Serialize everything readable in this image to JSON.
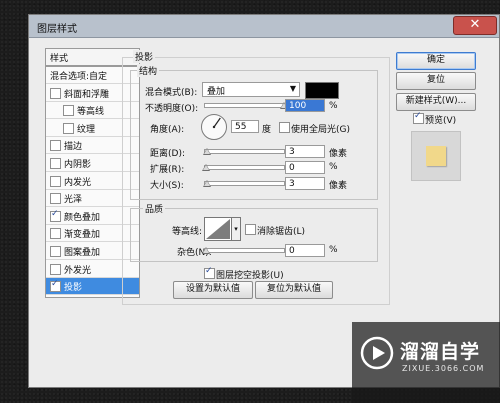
{
  "window": {
    "title": "图层样式",
    "close_glyph": "✕"
  },
  "left_panel": {
    "header": "样式",
    "items": [
      {
        "label": "混合选项:自定",
        "checkbox": false,
        "checked": false,
        "indent": false,
        "selected": false
      },
      {
        "label": "斜面和浮雕",
        "checkbox": true,
        "checked": false,
        "indent": false,
        "selected": false
      },
      {
        "label": "等高线",
        "checkbox": true,
        "checked": false,
        "indent": true,
        "selected": false
      },
      {
        "label": "纹理",
        "checkbox": true,
        "checked": false,
        "indent": true,
        "selected": false
      },
      {
        "label": "描边",
        "checkbox": true,
        "checked": false,
        "indent": false,
        "selected": false
      },
      {
        "label": "内阴影",
        "checkbox": true,
        "checked": false,
        "indent": false,
        "selected": false
      },
      {
        "label": "内发光",
        "checkbox": true,
        "checked": false,
        "indent": false,
        "selected": false
      },
      {
        "label": "光泽",
        "checkbox": true,
        "checked": false,
        "indent": false,
        "selected": false
      },
      {
        "label": "颜色叠加",
        "checkbox": true,
        "checked": true,
        "indent": false,
        "selected": false
      },
      {
        "label": "渐变叠加",
        "checkbox": true,
        "checked": false,
        "indent": false,
        "selected": false
      },
      {
        "label": "图案叠加",
        "checkbox": true,
        "checked": false,
        "indent": false,
        "selected": false
      },
      {
        "label": "外发光",
        "checkbox": true,
        "checked": false,
        "indent": false,
        "selected": false
      },
      {
        "label": "投影",
        "checkbox": true,
        "checked": true,
        "indent": false,
        "selected": true
      }
    ]
  },
  "panel": {
    "title": "投影",
    "structure": {
      "title": "结构",
      "blend_mode_label": "混合模式(B):",
      "blend_mode_value": "叠加",
      "shadow_color": "#000000",
      "opacity_label": "不透明度(O):",
      "opacity_value": "100",
      "opacity_unit": "%",
      "opacity_percent": 100,
      "angle_label": "角度(A):",
      "angle_value": "55",
      "angle_unit": "度",
      "global_light_label": "使用全局光(G)",
      "global_light_checked": false,
      "distance_label": "距离(D):",
      "distance_value": "3",
      "distance_unit": "像素",
      "spread_label": "扩展(R):",
      "spread_value": "0",
      "spread_unit": "%",
      "size_label": "大小(S):",
      "size_value": "3",
      "size_unit": "像素"
    },
    "quality": {
      "title": "品质",
      "contour_label": "等高线:",
      "antialias_label": "消除锯齿(L)",
      "antialias_checked": false,
      "noise_label": "杂色(N):",
      "noise_value": "0",
      "noise_unit": "%"
    },
    "knockout_label": "图层挖空投影(U)",
    "knockout_checked": true,
    "make_default_label": "设置为默认值",
    "reset_default_label": "复位为默认值"
  },
  "right_buttons": {
    "ok": "确定",
    "reset": "复位",
    "new_style": "新建样式(W)...",
    "preview_label": "预览(V)",
    "preview_checked": true,
    "preview_color": "#f1d88a"
  },
  "watermark": {
    "brand": "溜溜自学",
    "url": "ZIXUE.3066.COM"
  }
}
